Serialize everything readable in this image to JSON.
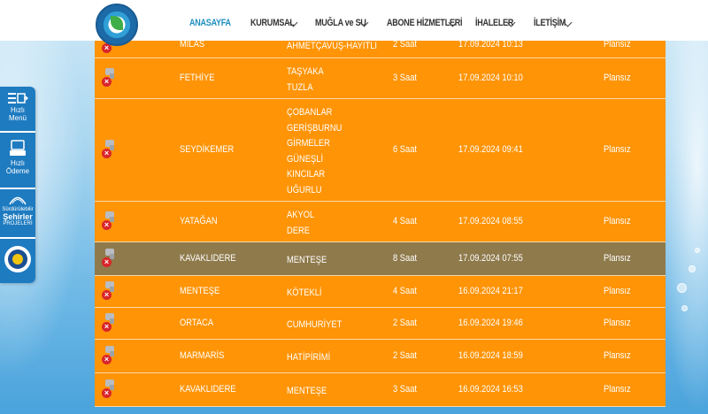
{
  "nav": {
    "items": [
      {
        "label": "ANASAYFA",
        "has_dropdown": false,
        "active": true
      },
      {
        "label": "KURUMSAL",
        "has_dropdown": true,
        "active": false
      },
      {
        "label": "MUĞLA ve SU",
        "has_dropdown": true,
        "active": false
      },
      {
        "label": "ABONE HİZMETLERİ",
        "has_dropdown": true,
        "active": false
      },
      {
        "label": "İHALELER",
        "has_dropdown": true,
        "active": false
      },
      {
        "label": "İLETİŞİM",
        "has_dropdown": true,
        "active": false
      }
    ]
  },
  "side_menu": {
    "quick_menu": "Hızlı Menü",
    "quick_menu_l1": "Hızlı",
    "quick_menu_l2": "Menü",
    "quick_pay_l1": "Hızlı",
    "quick_pay_l2": "Ödeme",
    "sustain_l1": "Sürdürülebilir",
    "sustain_l2": "Şehirler",
    "sustain_l3": "PROJELERİ"
  },
  "outages": [
    {
      "district": "MİLAS",
      "streets": [
        "AHMETÇAVUŞ-HAYITLI"
      ],
      "duration": "2 Saat",
      "date": "17.09.2024 10:13",
      "type": "Plansız",
      "highlight": false
    },
    {
      "district": "FETHİYE",
      "streets": [
        "TAŞYAKA",
        "TUZLA"
      ],
      "duration": "3 Saat",
      "date": "17.09.2024 10:10",
      "type": "Plansız",
      "highlight": false
    },
    {
      "district": "SEYDİKEMER",
      "streets": [
        "ÇOBANLAR",
        "GERİŞBURNU",
        "GİRMELER",
        "GÜNEŞLİ",
        "KINCILAR",
        "UĞURLU"
      ],
      "duration": "6 Saat",
      "date": "17.09.2024 09:41",
      "type": "Plansız",
      "highlight": false
    },
    {
      "district": "YATAĞAN",
      "streets": [
        "AKYOL",
        "DERE"
      ],
      "duration": "4 Saat",
      "date": "17.09.2024 08:55",
      "type": "Plansız",
      "highlight": false
    },
    {
      "district": "KAVAKLIDERE",
      "streets": [
        "MENTEŞE"
      ],
      "duration": "8 Saat",
      "date": "17.09.2024 07:55",
      "type": "Plansız",
      "highlight": true
    },
    {
      "district": "MENTEŞE",
      "streets": [
        "KÖTEKLİ"
      ],
      "duration": "4 Saat",
      "date": "16.09.2024 21:17",
      "type": "Plansız",
      "highlight": false
    },
    {
      "district": "ORTACA",
      "streets": [
        "CUMHURİYET"
      ],
      "duration": "2 Saat",
      "date": "16.09.2024 19:46",
      "type": "Plansız",
      "highlight": false
    },
    {
      "district": "MARMARİS",
      "streets": [
        "HATİPİRİMİ"
      ],
      "duration": "2 Saat",
      "date": "16.09.2024 18:59",
      "type": "Plansız",
      "highlight": false
    },
    {
      "district": "KAVAKLIDERE",
      "streets": [
        "MENTEŞE"
      ],
      "duration": "3 Saat",
      "date": "16.09.2024 16:53",
      "type": "Plansız",
      "highlight": false
    }
  ],
  "icons": {
    "row_icon": "faucet-closed-icon"
  },
  "colors": {
    "row": "#ff9406",
    "row_highlight": "#8f7a4c",
    "nav_active": "#1f8fbf",
    "side_menu": "#1e7bc0"
  }
}
